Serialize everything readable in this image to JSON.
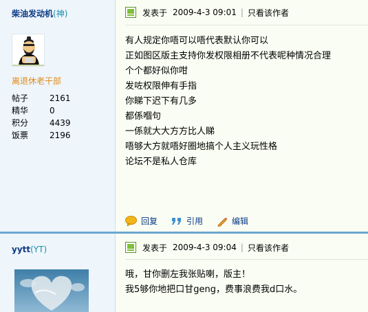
{
  "posts": [
    {
      "author": {
        "name": "柴油发动机",
        "tag": "(神)"
      },
      "rank": "离退休老干部",
      "stats": [
        {
          "label": "帖子",
          "value": "2161"
        },
        {
          "label": "精华",
          "value": "0"
        },
        {
          "label": "积分",
          "value": "4439"
        },
        {
          "label": "饭票",
          "value": "2196"
        }
      ],
      "posted_label": "发表于",
      "timestamp": "2009-4-3 09:01",
      "separator": "|",
      "view_author_only": "只看该作者",
      "body": [
        "有人规定你唔可以唔代表默认你可以",
        "正如图区版主支持你发权限相册不代表呢种情况合理",
        "个个都好似你咁",
        "发咗权限伸有手指",
        "你睇下迟下有几多",
        "都係嗰句",
        "一係就大大方方比人睇",
        "唔够大方就唔好圈地搞个人主义玩性格",
        "论坛不是私人仓库"
      ],
      "actions": {
        "reply": "回复",
        "quote": "引用",
        "edit": "编辑"
      }
    },
    {
      "author": {
        "name": "yytt",
        "tag": "(YT)"
      },
      "posted_label": "发表于",
      "timestamp": "2009-4-3 09:04",
      "separator": "|",
      "view_author_only": "只看该作者",
      "body": [
        "哦，甘你删左我张贴喇，版主！",
        "我5够你地把口甘geng，费事浪费我d口水。"
      ]
    }
  ]
}
